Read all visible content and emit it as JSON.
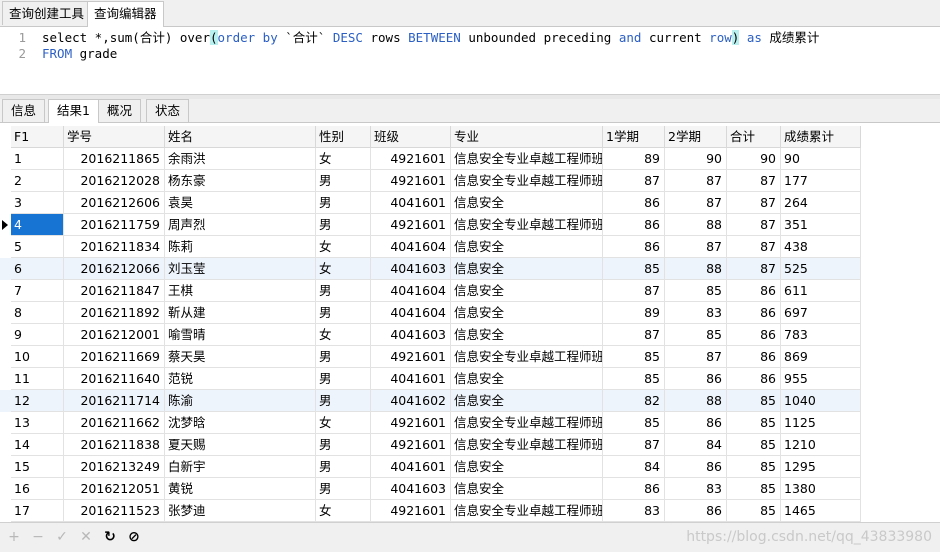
{
  "top_tabs": [
    "查询创建工具",
    "查询编辑器"
  ],
  "editor": {
    "line1": {
      "n": "1",
      "p1": "select *,sum(合计) over",
      "open": "(",
      "k1": "order by",
      "p2": " `合计` ",
      "k2": "DESC",
      "p3": " rows ",
      "k3": "BETWEEN",
      "p4": " unbounded preceding ",
      "k4": "and",
      "p5": " current ",
      "k5": "row",
      "close": ")",
      "p6": " ",
      "k6": "as",
      "p7": " 成绩累计"
    },
    "line2": {
      "n": "2",
      "k1": "FROM",
      "p1": " grade"
    }
  },
  "result_tabs": [
    "信息",
    "结果1",
    "概况",
    "状态"
  ],
  "grid": {
    "columns": [
      "F1",
      "学号",
      "姓名",
      "性别",
      "班级",
      "专业",
      "1学期",
      "2学期",
      "合计",
      "成绩累计"
    ],
    "rows": [
      [
        "1",
        "2016211865",
        "余雨洪",
        "女",
        "4921601",
        "信息安全专业卓越工程师班",
        "89",
        "90",
        "90",
        "90"
      ],
      [
        "2",
        "2016212028",
        "杨东豪",
        "男",
        "4921601",
        "信息安全专业卓越工程师班",
        "87",
        "87",
        "87",
        "177"
      ],
      [
        "3",
        "2016212606",
        "袁昊",
        "男",
        "4041601",
        "信息安全",
        "86",
        "87",
        "87",
        "264"
      ],
      [
        "4",
        "2016211759",
        "周声烈",
        "男",
        "4921601",
        "信息安全专业卓越工程师班",
        "86",
        "88",
        "87",
        "351"
      ],
      [
        "5",
        "2016211834",
        "陈莉",
        "女",
        "4041604",
        "信息安全",
        "86",
        "87",
        "87",
        "438"
      ],
      [
        "6",
        "2016212066",
        "刘玉莹",
        "女",
        "4041603",
        "信息安全",
        "85",
        "88",
        "87",
        "525"
      ],
      [
        "7",
        "2016211847",
        "王棋",
        "男",
        "4041604",
        "信息安全",
        "87",
        "85",
        "86",
        "611"
      ],
      [
        "8",
        "2016211892",
        "靳从建",
        "男",
        "4041604",
        "信息安全",
        "89",
        "83",
        "86",
        "697"
      ],
      [
        "9",
        "2016212001",
        "喻雪晴",
        "女",
        "4041603",
        "信息安全",
        "87",
        "85",
        "86",
        "783"
      ],
      [
        "10",
        "2016211669",
        "蔡天昊",
        "男",
        "4921601",
        "信息安全专业卓越工程师班",
        "85",
        "87",
        "86",
        "869"
      ],
      [
        "11",
        "2016211640",
        "范锐",
        "男",
        "4041601",
        "信息安全",
        "85",
        "86",
        "86",
        "955"
      ],
      [
        "12",
        "2016211714",
        "陈渝",
        "男",
        "4041602",
        "信息安全",
        "82",
        "88",
        "85",
        "1040"
      ],
      [
        "13",
        "2016211662",
        "沈梦晗",
        "女",
        "4921601",
        "信息安全专业卓越工程师班",
        "85",
        "86",
        "85",
        "1125"
      ],
      [
        "14",
        "2016211838",
        "夏天赐",
        "男",
        "4921601",
        "信息安全专业卓越工程师班",
        "87",
        "84",
        "85",
        "1210"
      ],
      [
        "15",
        "2016213249",
        "白新宇",
        "男",
        "4041601",
        "信息安全",
        "84",
        "86",
        "85",
        "1295"
      ],
      [
        "16",
        "2016212051",
        "黄锐",
        "男",
        "4041603",
        "信息安全",
        "86",
        "83",
        "85",
        "1380"
      ],
      [
        "17",
        "2016211523",
        "张梦迪",
        "女",
        "4921601",
        "信息安全专业卓越工程师班",
        "83",
        "86",
        "85",
        "1465"
      ]
    ]
  },
  "toolbar": {
    "add": "+",
    "remove": "−",
    "apply": "✓",
    "discard": "✕",
    "refresh": "↻",
    "stop": "⊘"
  },
  "watermark": "https://blog.csdn.net/qq_43833980",
  "icons": [
    "plus-icon",
    "minus-icon",
    "check-icon",
    "cross-icon",
    "refresh-icon",
    "stop-icon"
  ]
}
